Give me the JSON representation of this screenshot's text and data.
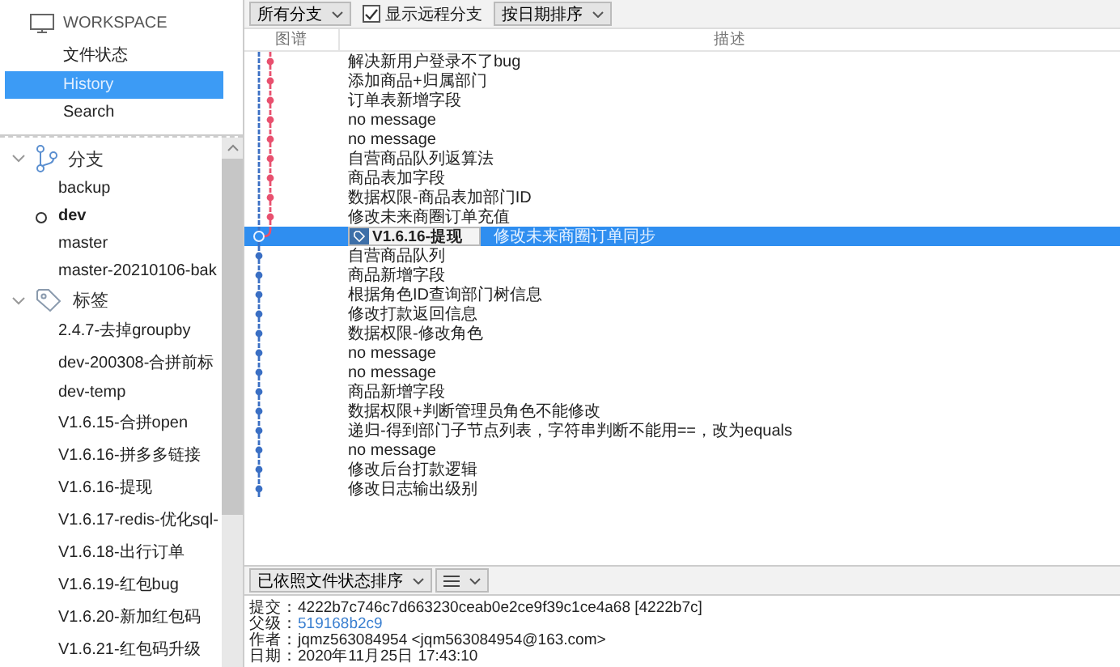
{
  "sidebar": {
    "workspace": {
      "title": "WORKSPACE",
      "items": [
        {
          "label": "文件状态",
          "selected": false
        },
        {
          "label": "History",
          "selected": true
        },
        {
          "label": "Search",
          "selected": false
        }
      ]
    },
    "sections": [
      {
        "title": "分支",
        "kind": "branch",
        "expanded": true,
        "items": [
          {
            "label": "backup",
            "current": false
          },
          {
            "label": "dev",
            "current": true
          },
          {
            "label": "master",
            "current": false
          },
          {
            "label": "master-20210106-bak",
            "current": false
          }
        ]
      },
      {
        "title": "标签",
        "kind": "tag",
        "expanded": true,
        "items": [
          {
            "label": "2.4.7-去掉groupby",
            "current": false
          },
          {
            "label": "dev-200308-合拼前标",
            "current": false
          },
          {
            "label": "dev-temp",
            "current": false
          },
          {
            "label": "V1.6.15-合拼open",
            "current": false
          },
          {
            "label": "V1.6.16-拼多多链接",
            "current": false
          },
          {
            "label": "V1.6.16-提现",
            "current": false
          },
          {
            "label": "V1.6.17-redis-优化sql-",
            "current": false
          },
          {
            "label": "V1.6.18-出行订单",
            "current": false
          },
          {
            "label": "V1.6.19-红包bug",
            "current": false
          },
          {
            "label": "V1.6.20-新加红包码",
            "current": false
          },
          {
            "label": "V1.6.21-红包码升级",
            "current": false
          }
        ]
      }
    ]
  },
  "toolbar": {
    "branch_filter": "所有分支",
    "show_remote": {
      "label": "显示远程分支",
      "checked": true
    },
    "sort": "按日期排序"
  },
  "table": {
    "columns": [
      "图谱",
      "描述"
    ],
    "rows": [
      {
        "kind": "side",
        "message": "解决新用户登录不了bug",
        "selected": false
      },
      {
        "kind": "side",
        "message": "添加商品+归属部门",
        "selected": false
      },
      {
        "kind": "side",
        "message": "订单表新增字段",
        "selected": false
      },
      {
        "kind": "side",
        "message": "no message",
        "selected": false
      },
      {
        "kind": "side",
        "message": "no message",
        "selected": false
      },
      {
        "kind": "side",
        "message": "自营商品队列返算法",
        "selected": false
      },
      {
        "kind": "side",
        "message": "商品表加字段",
        "selected": false
      },
      {
        "kind": "side",
        "message": "数据权限-商品表加部门ID",
        "selected": false
      },
      {
        "kind": "side",
        "message": "修改未来商圈订单充值",
        "selected": false
      },
      {
        "kind": "merge",
        "tag": "V1.6.16-提现",
        "message": "修改未来商圈订单同步",
        "selected": true
      },
      {
        "kind": "main",
        "message": "自营商品队列",
        "selected": false
      },
      {
        "kind": "main",
        "message": "商品新增字段",
        "selected": false
      },
      {
        "kind": "main",
        "message": "根据角色ID查询部门树信息",
        "selected": false
      },
      {
        "kind": "main",
        "message": "修改打款返回信息",
        "selected": false
      },
      {
        "kind": "main",
        "message": "数据权限-修改角色",
        "selected": false
      },
      {
        "kind": "main",
        "message": "no message",
        "selected": false
      },
      {
        "kind": "main",
        "message": "no message",
        "selected": false
      },
      {
        "kind": "main",
        "message": "商品新增字段",
        "selected": false
      },
      {
        "kind": "main",
        "message": "数据权限+判断管理员角色不能修改",
        "selected": false
      },
      {
        "kind": "main",
        "message": "递归-得到部门子节点列表，字符串判断不能用==，改为equals",
        "selected": false
      },
      {
        "kind": "main",
        "message": "no message",
        "selected": false
      },
      {
        "kind": "main",
        "message": "修改后台打款逻辑",
        "selected": false
      },
      {
        "kind": "main",
        "message": "修改日志输出级别",
        "selected": false
      }
    ]
  },
  "file_toolbar": {
    "sort": "已依照文件状态排序"
  },
  "details": [
    {
      "label": "提交：",
      "value": "4222b7c746c7d663230ceab0e2ce9f39c1ce4a68 [4222b7c]",
      "kind": "text"
    },
    {
      "label": "父级：",
      "value": "519168b2c9",
      "kind": "link"
    },
    {
      "label": "作者：",
      "value": "jqmz563084954 <jqm563084954@163.com>",
      "kind": "text"
    },
    {
      "label": "日期：",
      "value": "2020年11月25日 17:43:10",
      "kind": "text"
    }
  ]
}
